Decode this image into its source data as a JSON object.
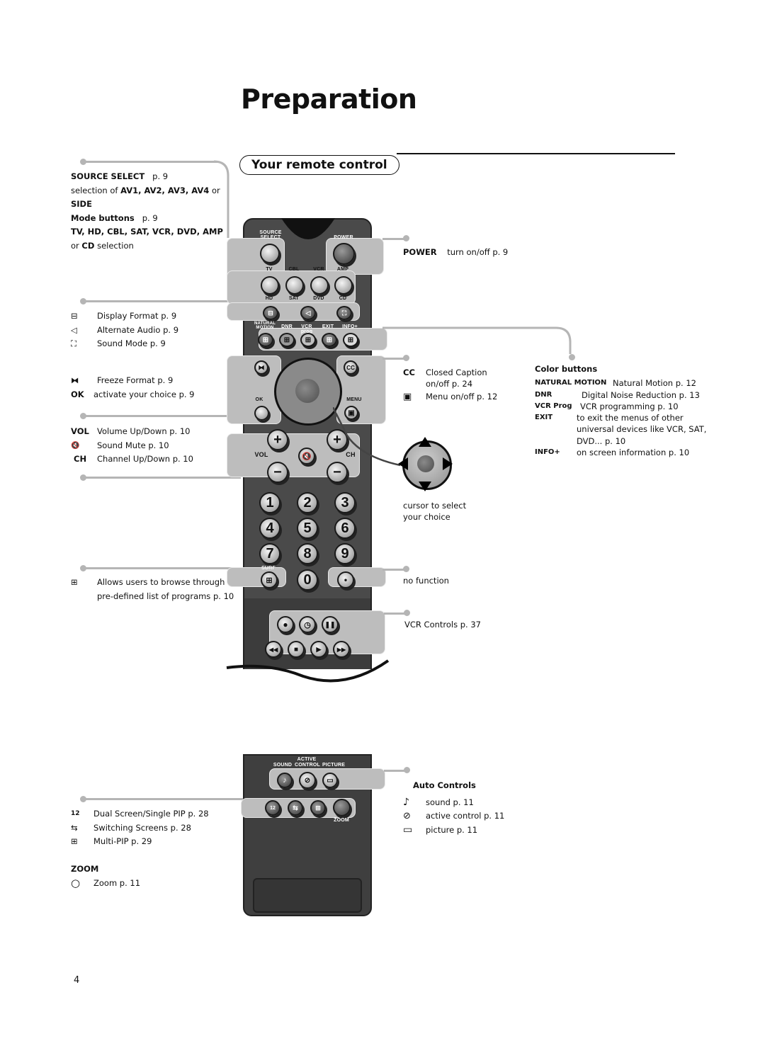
{
  "page": {
    "title": "Preparation",
    "section": "Your remote control",
    "page_number": "4"
  },
  "left": {
    "source_select": {
      "label": "SOURCE SELECT",
      "page": "p. 9",
      "line2_pre": "selection of ",
      "line2_bold": "AV1, AV2, AV3, AV4",
      "line2_post": " or",
      "line3": "SIDE"
    },
    "mode_buttons": {
      "label": "Mode buttons",
      "page": "p. 9",
      "devices": "TV, HD, CBL, SAT, VCR, DVD, AMP",
      "line_pre": "or ",
      "line_bold": "CD",
      "line_post": " selection"
    },
    "format_items": [
      {
        "icon": "display-format-icon",
        "glyph": "⊟",
        "text": "Display Format   p. 9"
      },
      {
        "icon": "alternate-audio-icon",
        "glyph": "◁",
        "text": "Alternate Audio  p. 9"
      },
      {
        "icon": "sound-mode-icon",
        "glyph": "⛶",
        "text": "Sound Mode  p. 9"
      }
    ],
    "freeze": {
      "glyph": "⧓",
      "text": "Freeze Format  p. 9"
    },
    "ok": {
      "label": "OK",
      "text": "activate your choice   p. 9"
    },
    "vol_items": [
      {
        "label": "VOL",
        "text": "Volume Up/Down   p. 10"
      },
      {
        "label": "🔇",
        "text": "Sound Mute  p. 10"
      },
      {
        "label": "CH",
        "text": "Channel Up/Down  p. 10"
      }
    ],
    "surf": {
      "glyph": "⊞",
      "line1": "Allows users to browse through",
      "line2": "pre-defined list of programs    p. 10"
    },
    "pip_items": [
      {
        "icon": "dual-screen-icon",
        "glyph": "12",
        "text": "Dual Screen/Single PIP    p. 28"
      },
      {
        "icon": "switching-screens-icon",
        "glyph": "⇆",
        "text": "Switching Screens    p. 28"
      },
      {
        "icon": "multi-pip-icon",
        "glyph": "⊞",
        "text": "Multi-PIP    p. 29"
      }
    ],
    "zoom": {
      "heading": "ZOOM",
      "glyph": "○",
      "text": "Zoom  p. 11"
    }
  },
  "right": {
    "power": {
      "label": "POWER",
      "text": "turn on/off    p. 9"
    },
    "cc": {
      "label": "CC",
      "line1": "Closed Caption",
      "line2": "on/off   p. 24"
    },
    "menu": {
      "glyph": "▣",
      "text": "Menu on/off  p. 12"
    },
    "color_buttons": {
      "heading": "Color buttons",
      "items": [
        {
          "label": "NATURAL  MOTION",
          "text": "Natural Motion   p. 12"
        },
        {
          "label": "DNR",
          "text": "Digital Noise Reduction    p. 13"
        },
        {
          "label": "VCR Prog",
          "text": "VCR programming   p. 10"
        },
        {
          "label": "EXIT",
          "text": "to exit the menus of other"
        },
        {
          "label": "",
          "text": "universal devices like VCR, SAT,"
        },
        {
          "label": "",
          "text": "DVD...     p. 10"
        },
        {
          "label": "INFO+",
          "text": "on screen information   p. 10"
        }
      ]
    },
    "cursor": {
      "line1": "cursor to select",
      "line2": "your choice"
    },
    "no_function": "no function",
    "vcr_controls": "VCR Controls    p. 37",
    "auto_controls": {
      "heading": "Auto Controls",
      "items": [
        {
          "icon": "sound-note-icon",
          "glyph": "♪",
          "text": "sound   p. 11"
        },
        {
          "icon": "active-control-icon",
          "glyph": "⊘",
          "text": "active control   p. 11"
        },
        {
          "icon": "picture-icon",
          "glyph": "▭",
          "text": "picture   p. 11"
        }
      ]
    }
  },
  "remote": {
    "source_select": "SOURCE SELECT",
    "power": "POWER",
    "modes_top": [
      "TV",
      "CBL",
      "VCR",
      "AMP"
    ],
    "modes_bottom": [
      "HD",
      "SAT",
      "DVD",
      "CD"
    ],
    "color_labels": [
      "NATURAL MOTION",
      "DNR",
      "VCR prog",
      "EXIT",
      "INFO+"
    ],
    "ok": "OK",
    "cc": "CC",
    "menu": "MENU",
    "vol": "VOL",
    "ch": "CH",
    "plus": "+",
    "minus": "−",
    "digits": [
      "1",
      "2",
      "3",
      "4",
      "5",
      "6",
      "7",
      "8",
      "9",
      "0"
    ],
    "surf": "SURF",
    "active": "ACTIVE",
    "sound": "SOUND",
    "control": "CONTROL",
    "picture": "PICTURE",
    "zoom": "ZOOM"
  }
}
